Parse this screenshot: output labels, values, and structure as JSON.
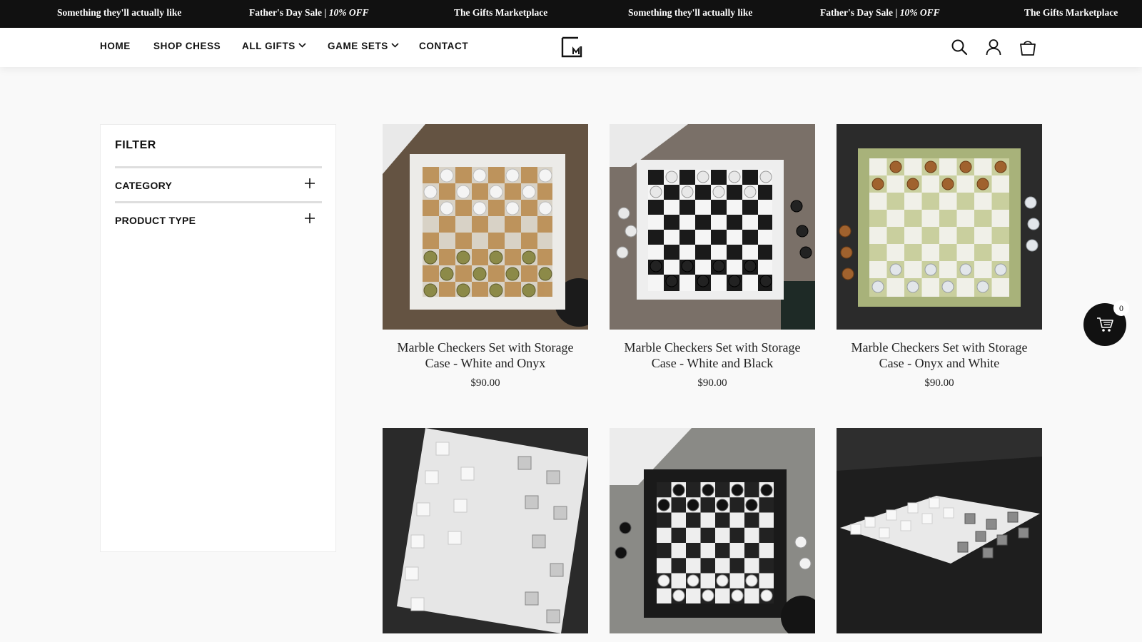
{
  "announcement": {
    "items": [
      {
        "text": "Something they'll actually like",
        "italic": ""
      },
      {
        "text": "Father's Day Sale | ",
        "italic": "10% OFF"
      },
      {
        "text": "The Gifts Marketplace",
        "italic": ""
      },
      {
        "text": "Something they'll actually like",
        "italic": ""
      },
      {
        "text": "Father's Day Sale | ",
        "italic": "10% OFF"
      },
      {
        "text": "The Gifts Marketplace",
        "italic": ""
      }
    ]
  },
  "nav": {
    "items": [
      {
        "label": "HOME",
        "dropdown": false
      },
      {
        "label": "SHOP CHESS",
        "dropdown": false
      },
      {
        "label": "ALL GIFTS",
        "dropdown": true
      },
      {
        "label": "GAME SETS",
        "dropdown": true
      },
      {
        "label": "CONTACT",
        "dropdown": false
      }
    ],
    "icons": [
      "search-icon",
      "user-icon",
      "cart-icon"
    ]
  },
  "filter": {
    "title": "FILTER",
    "groups": [
      {
        "label": "CATEGORY",
        "icon": "plus-icon"
      },
      {
        "label": "PRODUCT TYPE",
        "icon": "plus-icon"
      }
    ]
  },
  "products": [
    {
      "name": "Marble Checkers Set with Storage Case - White and Onyx",
      "price": "$90.00"
    },
    {
      "name": "Marble Checkers Set with Storage Case - White and Black",
      "price": "$90.00"
    },
    {
      "name": "Marble Checkers Set with Storage Case - Onyx and White",
      "price": "$90.00"
    },
    {
      "name": "",
      "price": ""
    },
    {
      "name": "",
      "price": ""
    },
    {
      "name": "",
      "price": ""
    }
  ],
  "cart": {
    "count": "0"
  },
  "colors": {
    "bar": "#111111",
    "page_bg": "#f9f9f9",
    "panel_bg": "#ffffff"
  }
}
